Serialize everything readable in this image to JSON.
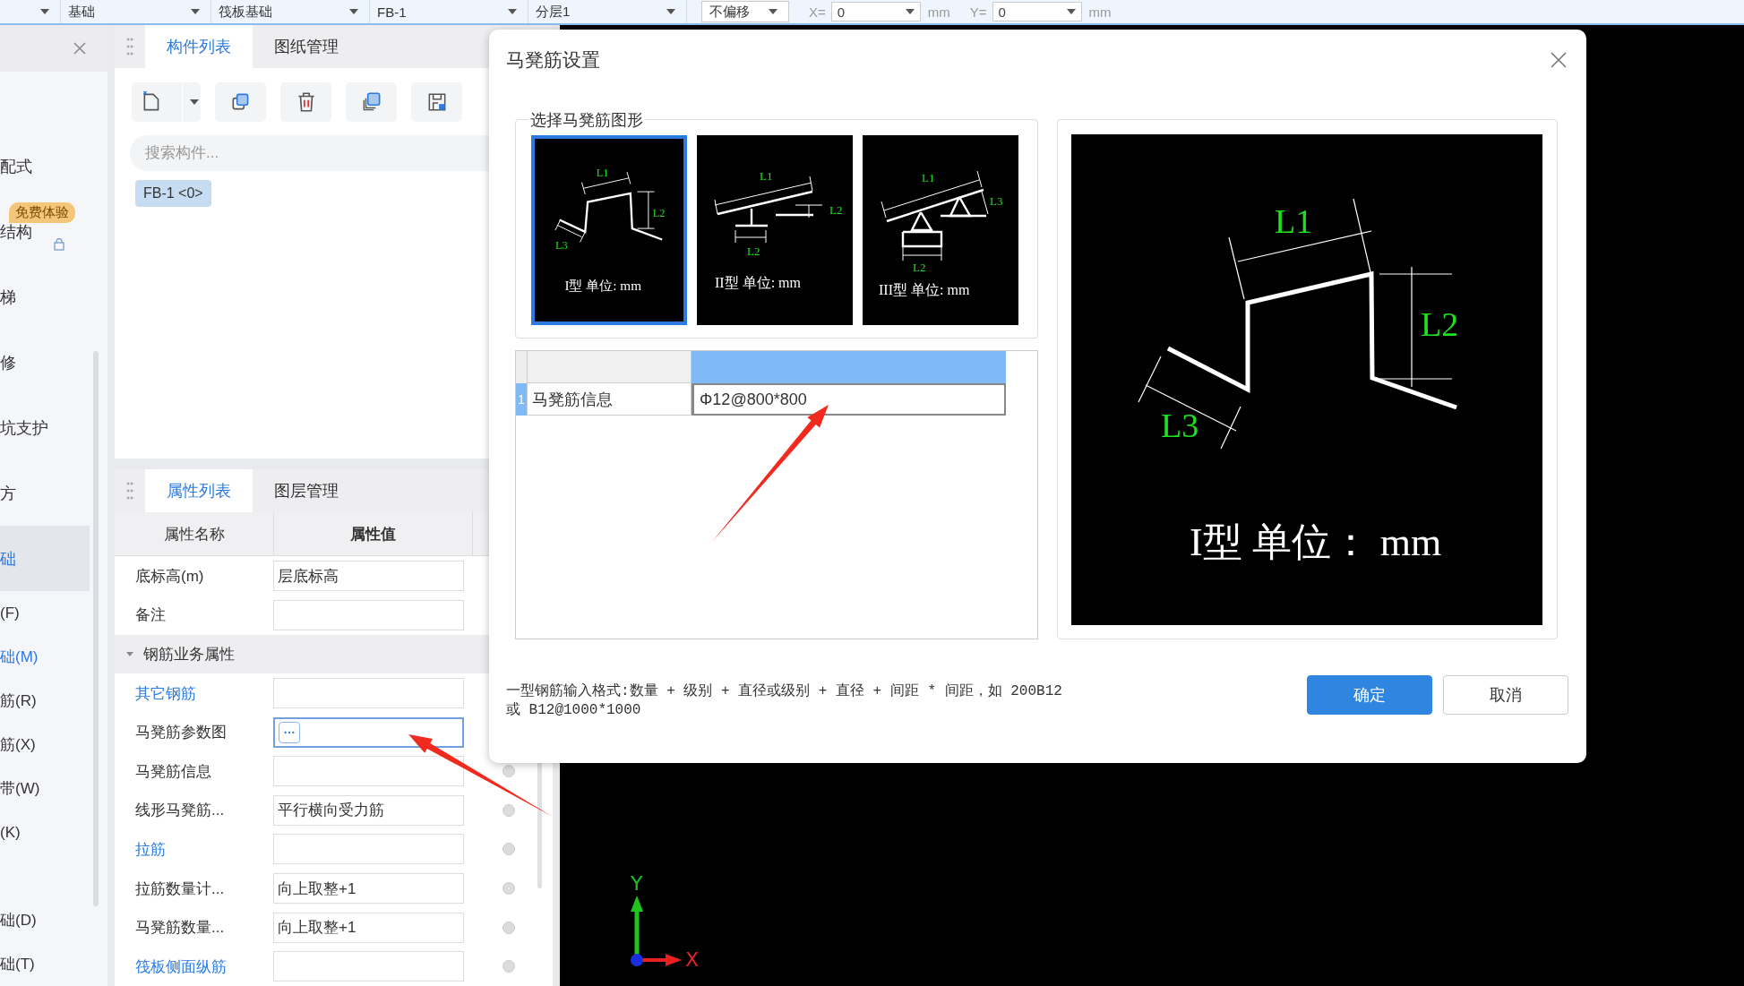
{
  "top_bar": {
    "combos": [
      {
        "kind": "flat"
      },
      {
        "kind": "flat",
        "label": "基础"
      },
      {
        "kind": "flat",
        "label": "筏板基础"
      },
      {
        "kind": "flat",
        "label": "FB-1"
      },
      {
        "kind": "flat",
        "label": "分层1"
      },
      {
        "kind": "boxed",
        "label": "不偏移"
      }
    ],
    "coords": [
      {
        "axis": "X=",
        "value": "0",
        "unit": "mm"
      },
      {
        "axis": "Y=",
        "value": "0",
        "unit": "mm"
      }
    ]
  },
  "sidebar": {
    "items": [
      {
        "kind": "major",
        "label": "配式",
        "selected": false,
        "active": false
      },
      {
        "kind": "major",
        "label": "结构",
        "selected": false,
        "active": false,
        "badge": "免费体验"
      },
      {
        "kind": "major",
        "label": "梯",
        "selected": false,
        "active": false
      },
      {
        "kind": "major",
        "label": "修",
        "selected": false,
        "active": false
      },
      {
        "kind": "major",
        "label": "坑支护",
        "selected": false,
        "active": false
      },
      {
        "kind": "major",
        "label": "方",
        "selected": false,
        "active": false
      },
      {
        "kind": "major",
        "label": "础",
        "selected": true,
        "active": true
      },
      {
        "kind": "minor",
        "label": "(F)",
        "selected": false,
        "active": false
      },
      {
        "kind": "minor",
        "label": "础(M)",
        "selected": false,
        "active": true
      },
      {
        "kind": "minor",
        "label": "筋(R)",
        "selected": false,
        "active": false
      },
      {
        "kind": "minor",
        "label": "筋(X)",
        "selected": false,
        "active": false
      },
      {
        "kind": "minor",
        "label": "带(W)",
        "selected": false,
        "active": false
      },
      {
        "kind": "minor",
        "label": "(K)",
        "selected": false,
        "active": false
      },
      {
        "kind": "minor-gap",
        "label": "础(D)",
        "selected": false,
        "active": false
      },
      {
        "kind": "minor",
        "label": "础(T)",
        "selected": false,
        "active": false
      }
    ]
  },
  "component_panel": {
    "tabs": [
      {
        "label": "构件列表",
        "selected": true
      },
      {
        "label": "图纸管理",
        "selected": false
      }
    ],
    "search": {
      "placeholder": "搜索构件..."
    },
    "components": [
      {
        "label": "FB-1 <0>",
        "selected": true
      }
    ]
  },
  "property_panel": {
    "tabs": [
      {
        "label": "属性列表",
        "selected": true
      },
      {
        "label": "图层管理",
        "selected": false
      }
    ],
    "columns": [
      "属性名称",
      "属性值"
    ],
    "rows": [
      {
        "kind": "row",
        "name": "底标高(m)",
        "value": "层底标高",
        "link": false,
        "focused": false
      },
      {
        "kind": "row",
        "name": "备注",
        "link": false,
        "focused": false
      },
      {
        "kind": "group",
        "name": "钢筋业务属性",
        "expanded": true
      },
      {
        "kind": "row",
        "name": "其它钢筋",
        "link": true,
        "focused": false
      },
      {
        "kind": "row",
        "name": "马凳筋参数图",
        "link": false,
        "focused": true
      },
      {
        "kind": "row",
        "name": "马凳筋信息",
        "link": false,
        "focused": false,
        "checked": false
      },
      {
        "kind": "row",
        "name": "线形马凳筋...",
        "value": "平行横向受力筋",
        "link": false,
        "focused": false,
        "checked": false
      },
      {
        "kind": "row",
        "name": "拉筋",
        "link": true,
        "focused": false,
        "checked": false
      },
      {
        "kind": "row",
        "name": "拉筋数量计...",
        "value": "向上取整+1",
        "link": false,
        "focused": false,
        "checked": false
      },
      {
        "kind": "row",
        "name": "马凳筋数量...",
        "value": "向上取整+1",
        "link": false,
        "focused": false,
        "checked": false
      },
      {
        "kind": "row",
        "name": "筏板侧面纵筋",
        "link": true,
        "focused": false,
        "checked": false
      }
    ]
  },
  "canvas": {
    "axis_labels": [
      "Y",
      "X"
    ]
  },
  "dialog": {
    "title": "马凳筋设置",
    "shape_group": {
      "title": "选择马凳筋图形",
      "shapes": [
        {
          "kind": "I",
          "caption": "I型 单位: mm",
          "labels": [
            "L1",
            "L2",
            "L3"
          ],
          "selected": true
        },
        {
          "kind": "II",
          "caption": "II型 单位: mm",
          "labels": [
            "L1",
            "L2",
            "L2"
          ],
          "selected": false
        },
        {
          "kind": "III",
          "caption": "III型 单位: mm",
          "labels": [
            "L1",
            "L2",
            "L3"
          ],
          "selected": false
        }
      ]
    },
    "table": {
      "rows": [
        {
          "number": "1",
          "name": "马凳筋信息",
          "value": "Φ12@800*800",
          "selected": true
        }
      ]
    },
    "preview": {
      "kind": "I",
      "caption": "I型 单位： mm",
      "labels": [
        "L1",
        "L2",
        "L3"
      ]
    },
    "hint": "一型钢筋输入格式:数量 + 级别 + 直径或级别 + 直径 + 间距 * 间距，如 200B12\n或 B12@1000*1000",
    "buttons": [
      {
        "label": "确定",
        "primary": true
      },
      {
        "label": "取消",
        "primary": false
      }
    ]
  }
}
